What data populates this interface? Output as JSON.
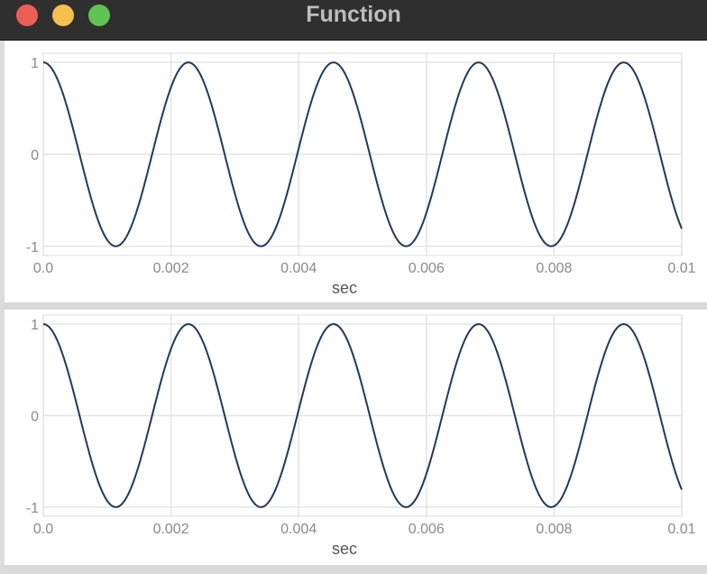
{
  "window": {
    "title": "Function",
    "colors": {
      "close": "#ec5f56",
      "minimize": "#f6be4f",
      "maximize": "#5fc452",
      "line": "#1f3a5a",
      "grid": "#e4e4e4",
      "tick_text": "#8a8a8a",
      "label_text": "#555555"
    }
  },
  "chart_data": [
    {
      "type": "line",
      "function": "cos",
      "frequency_hz": 440,
      "amplitude": 1,
      "xlabel": "sec",
      "ylabel": "",
      "xlim": [
        0,
        0.01
      ],
      "ylim": [
        -1.1,
        1.1
      ],
      "xticks": [
        "0.0",
        "0.002",
        "0.004",
        "0.006",
        "0.008",
        "0.01"
      ],
      "xtick_values": [
        0,
        0.002,
        0.004,
        0.006,
        0.008,
        0.01
      ],
      "yticks": [
        "1",
        "0",
        "-1"
      ],
      "ytick_values": [
        1,
        0,
        -1
      ],
      "grid": true
    },
    {
      "type": "line",
      "function": "cos",
      "frequency_hz": 440,
      "amplitude": 1,
      "xlabel": "sec",
      "ylabel": "",
      "xlim": [
        0,
        0.01
      ],
      "ylim": [
        -1.1,
        1.1
      ],
      "xticks": [
        "0.0",
        "0.002",
        "0.004",
        "0.006",
        "0.008",
        "0.01"
      ],
      "xtick_values": [
        0,
        0.002,
        0.004,
        0.006,
        0.008,
        0.01
      ],
      "yticks": [
        "1",
        "0",
        "-1"
      ],
      "ytick_values": [
        1,
        0,
        -1
      ],
      "grid": true
    }
  ]
}
